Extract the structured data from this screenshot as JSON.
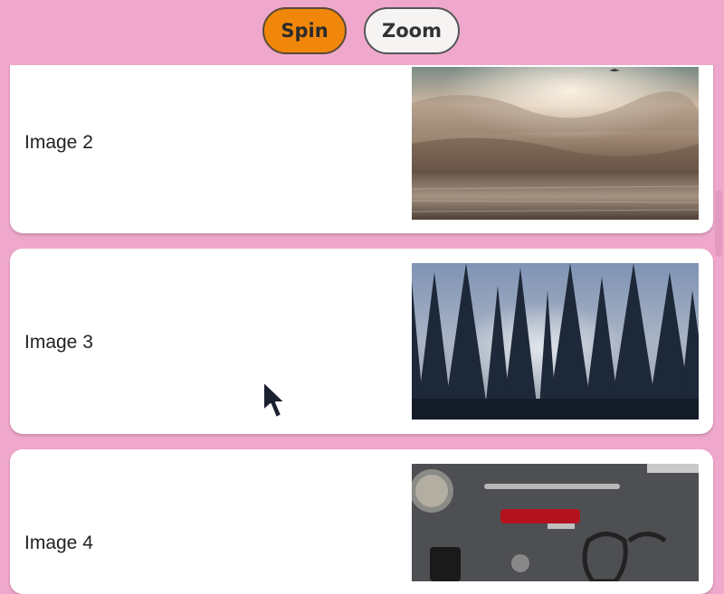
{
  "toolbar": {
    "spin_label": "Spin",
    "zoom_label": "Zoom"
  },
  "items": [
    {
      "label": "Image 2",
      "image": "ocean sunset with clouds"
    },
    {
      "label": "Image 3",
      "image": "pine forest silhouette"
    },
    {
      "label": "Image 4",
      "image": "flat-lay of everyday items"
    }
  ],
  "colors": {
    "background": "#efa8cb",
    "spin_button": "#f0870a",
    "zoom_button": "#f6f3f3",
    "card": "#ffffff"
  }
}
